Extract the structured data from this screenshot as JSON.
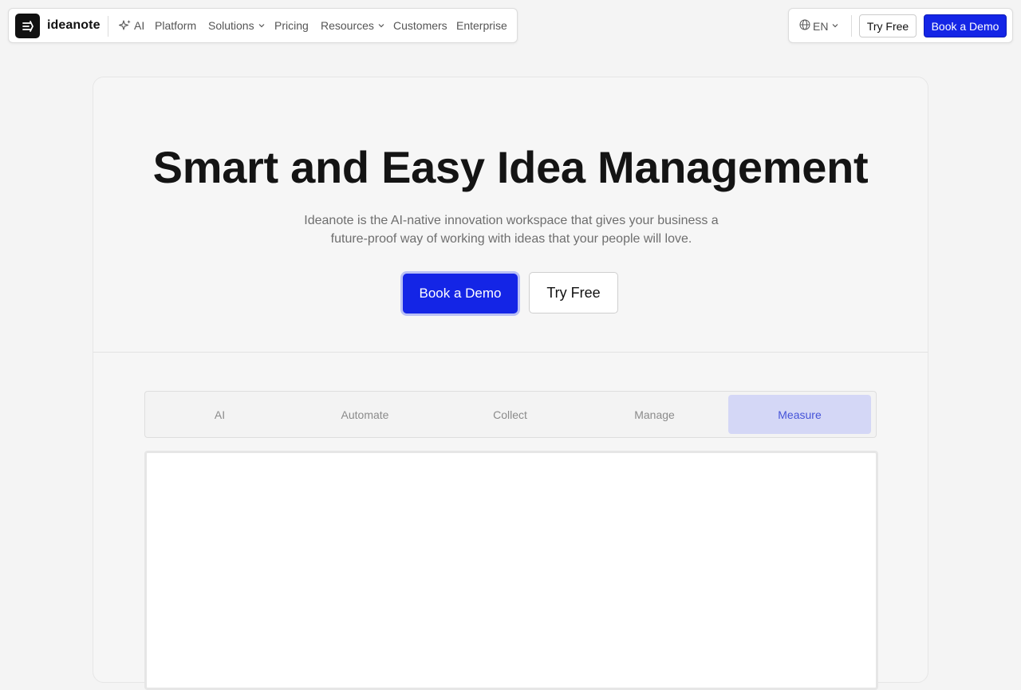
{
  "brand": {
    "name": "ideanote",
    "logo_icon": "ideanote-logo-icon"
  },
  "nav": {
    "items": [
      {
        "label": "AI",
        "icon": "sparkle-icon"
      },
      {
        "label": "Platform"
      },
      {
        "label": "Solutions",
        "dropdown": true
      },
      {
        "label": "Pricing"
      },
      {
        "label": "Resources",
        "dropdown": true
      },
      {
        "label": "Customers"
      },
      {
        "label": "Enterprise"
      }
    ],
    "language": "EN",
    "try_free": "Try Free",
    "book_demo": "Book a Demo"
  },
  "hero": {
    "title": "Smart and Easy Idea Management",
    "subtitle_line1": "Ideanote is the AI-native innovation workspace that gives your business a",
    "subtitle_line2": "future-proof way of working with ideas that your people will love.",
    "book_demo": "Book a Demo",
    "try_free": "Try Free"
  },
  "tabs": {
    "items": [
      "AI",
      "Automate",
      "Collect",
      "Manage",
      "Measure"
    ],
    "active": "Measure"
  },
  "colors": {
    "primary": "#1425e6",
    "active_tab_bg": "#d4d7f6",
    "active_tab_text": "#4553d8"
  }
}
